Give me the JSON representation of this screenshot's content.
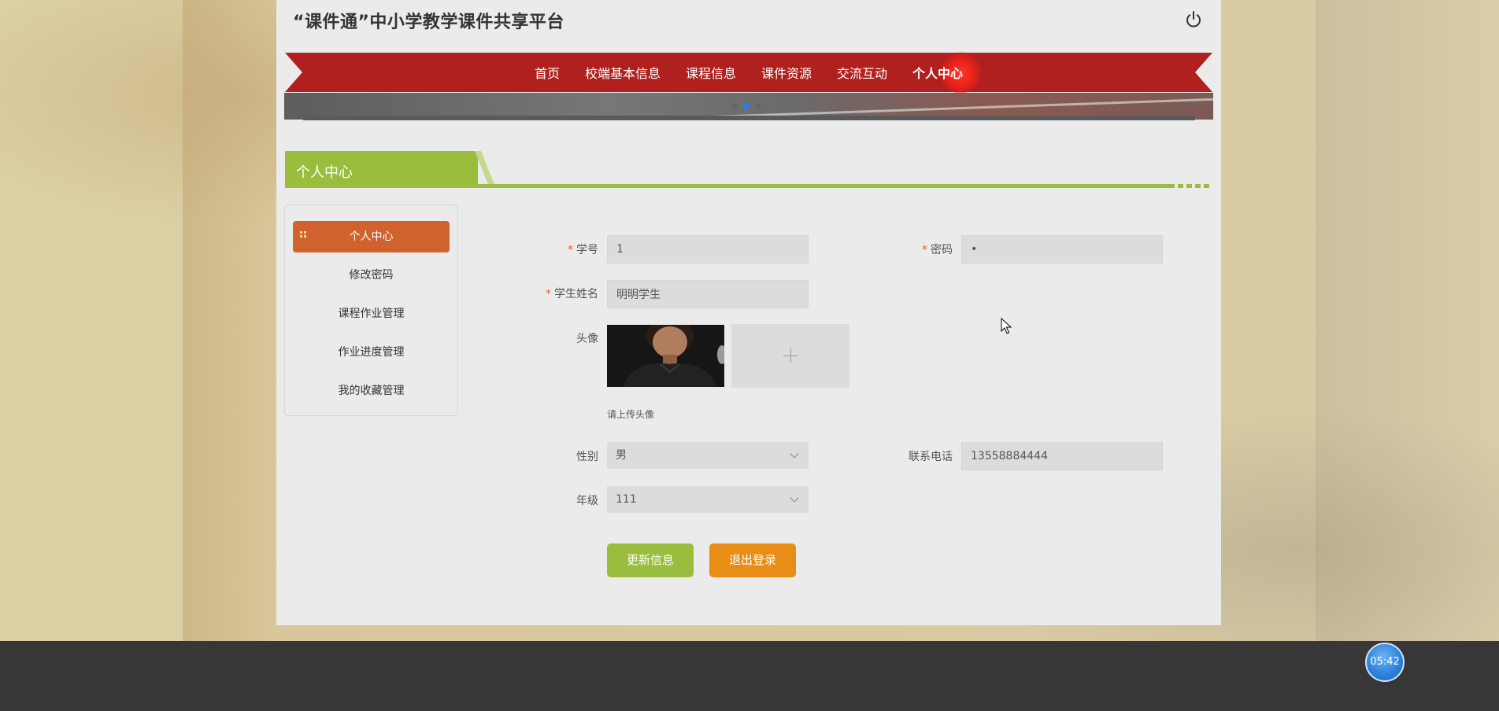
{
  "site": {
    "title": "“课件通”中小学教学课件共享平台"
  },
  "header": {
    "power_icon": "power-icon"
  },
  "nav": {
    "items": [
      "首页",
      "校端基本信息",
      "课程信息",
      "课件资源",
      "交流互动",
      "个人中心"
    ],
    "active_index": 5,
    "color": "#b0201e"
  },
  "banner": {
    "dot_count": 3,
    "active_dot": 1
  },
  "section": {
    "title": "个人中心",
    "color": "#9bbd3e"
  },
  "sidebar": {
    "items": [
      "个人中心",
      "修改密码",
      "课程作业管理",
      "作业进度管理",
      "我的收藏管理"
    ],
    "active_index": 0,
    "active_icon": "grid-icon",
    "active_color": "#d0622e"
  },
  "form": {
    "student_id": {
      "label": "学号",
      "value": "1",
      "required": true
    },
    "password": {
      "label": "密码",
      "value": "•",
      "required": true
    },
    "student_name": {
      "label": "学生姓名",
      "value": "明明学生",
      "required": true
    },
    "avatar": {
      "label": "头像",
      "upload_icon": "plus-icon",
      "hint": "请上传头像"
    },
    "gender": {
      "label": "性别",
      "value": "男"
    },
    "phone": {
      "label": "联系电话",
      "value": "13558884444"
    },
    "grade": {
      "label": "年级",
      "value": "111"
    }
  },
  "buttons": {
    "update": "更新信息",
    "logout": "退出登录"
  },
  "timer": {
    "value": "05:42"
  }
}
